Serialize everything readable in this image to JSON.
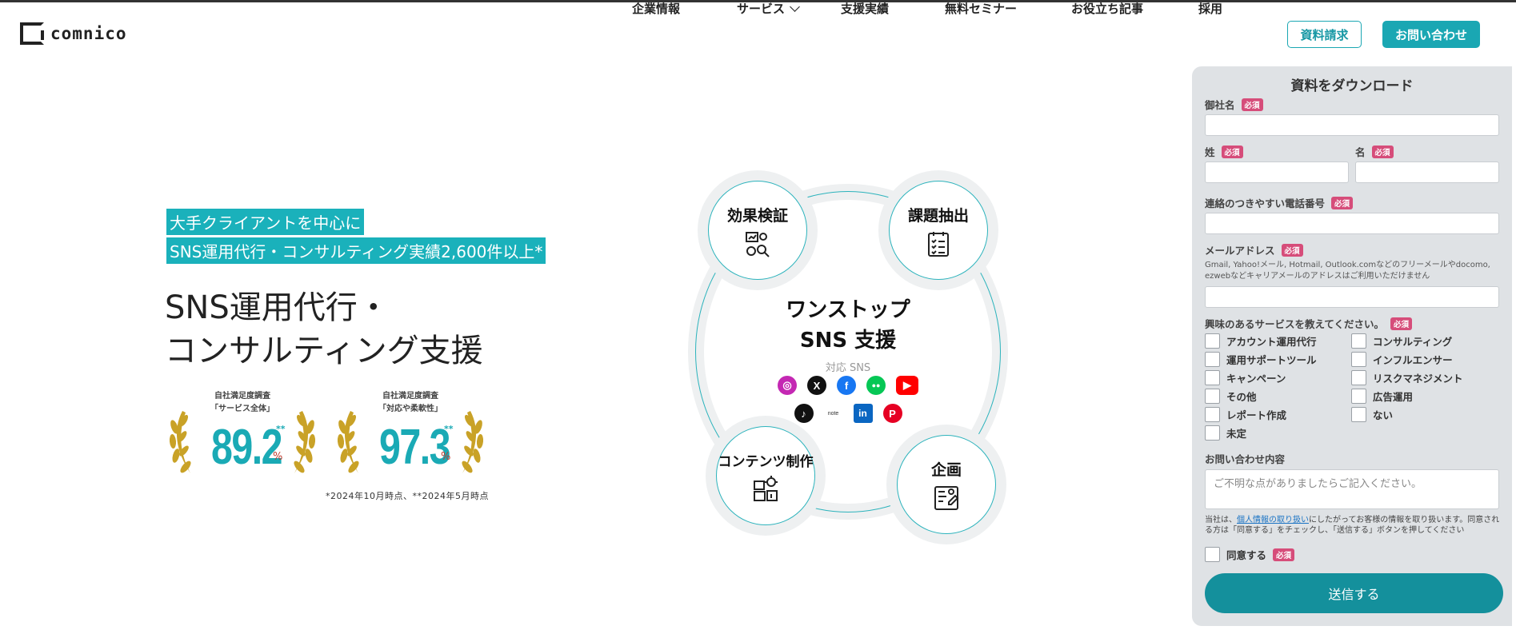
{
  "header": {
    "logo_text": "comnico",
    "nav": [
      {
        "label": "企業情報"
      },
      {
        "label": "サービス"
      },
      {
        "label": "支援実績"
      },
      {
        "label": "無料セミナー"
      },
      {
        "label": "お役立ち記事"
      },
      {
        "label": "採用"
      }
    ],
    "doc_button": "資料請求",
    "contact_button": "お問い合わせ"
  },
  "hero": {
    "highlight_1": "大手クライアントを中心に",
    "highlight_2": "SNS運用代行・コンサルティング実績2,600件以上*",
    "title_1": "SNS運用代行・",
    "title_2": "コンサルティング支援",
    "awards": [
      {
        "cap1": "自社満足度調査",
        "cap2": "「サービス全体」",
        "value": "89.2",
        "stars": "**",
        "unit": "%"
      },
      {
        "cap1": "自社満足度調査",
        "cap2": "「対応や柔軟性」",
        "value": "97.3",
        "stars": "**",
        "unit": "%"
      }
    ],
    "footnote": "*2024年10月時点、**2024年5月時点"
  },
  "diagram": {
    "center_1": "ワンストップ",
    "center_2": "SNS 支援",
    "sns_label": "対応 SNS",
    "nodes": [
      {
        "label": "効果検証",
        "icon": "analytics-icon"
      },
      {
        "label": "課題抽出",
        "icon": "checklist-icon"
      },
      {
        "label": "コンテンツ制作",
        "icon": "content-icon"
      },
      {
        "label": "企画",
        "icon": "planning-icon"
      }
    ],
    "sns_row1": [
      {
        "name": "instagram-icon",
        "glyph": "◎",
        "color": "#c428b3"
      },
      {
        "name": "x-icon",
        "glyph": "𝕏",
        "color": "#111111"
      },
      {
        "name": "facebook-icon",
        "glyph": "f",
        "color": "#1877f2"
      },
      {
        "name": "line-icon",
        "glyph": "…",
        "color": "#06c755"
      },
      {
        "name": "youtube-icon",
        "glyph": "▶",
        "color": "#ff0000"
      }
    ],
    "sns_row2": [
      {
        "name": "tiktok-icon",
        "glyph": "♪",
        "color": "#111111"
      },
      {
        "name": "note-icon",
        "glyph": "note",
        "color": "#ffffff"
      },
      {
        "name": "linkedin-icon",
        "glyph": "in",
        "color": "#0a66c2"
      },
      {
        "name": "pinterest-icon",
        "glyph": "P",
        "color": "#e60023"
      }
    ]
  },
  "form": {
    "title": "資料をダウンロード",
    "required": "必須",
    "company_label": "御社名",
    "last_name_label": "姓",
    "first_name_label": "名",
    "phone_label": "連絡のつきやすい電話番号",
    "email_label": "メールアドレス",
    "email_note": "Gmail, Yahoo!メール, Hotmail, Outlook.comなどのフリーメールやdocomo, ezwebなどキャリアメールのアドレスはご利用いただけません",
    "interest_label": "興味のあるサービスを教えてください。",
    "options_left": [
      "アカウント運用代行",
      "運用サポートツール",
      "キャンペーン",
      "その他",
      "レポート作成",
      "未定"
    ],
    "options_right": [
      "コンサルティング",
      "インフルエンサー",
      "リスクマネジメント",
      "広告運用",
      "ない"
    ],
    "inquiry_label": "お問い合わせ内容",
    "inquiry_placeholder": "ご不明な点がありましたらご記入ください。",
    "policy_pre": "当社は、",
    "policy_link": "個人情報の取り扱い",
    "policy_post": "にしたがってお客様の情報を取り扱います。同意される方は「同意する」をチェックし、「送信する」ボタンを押してください",
    "agree_label": "同意する",
    "submit": "送信する"
  }
}
